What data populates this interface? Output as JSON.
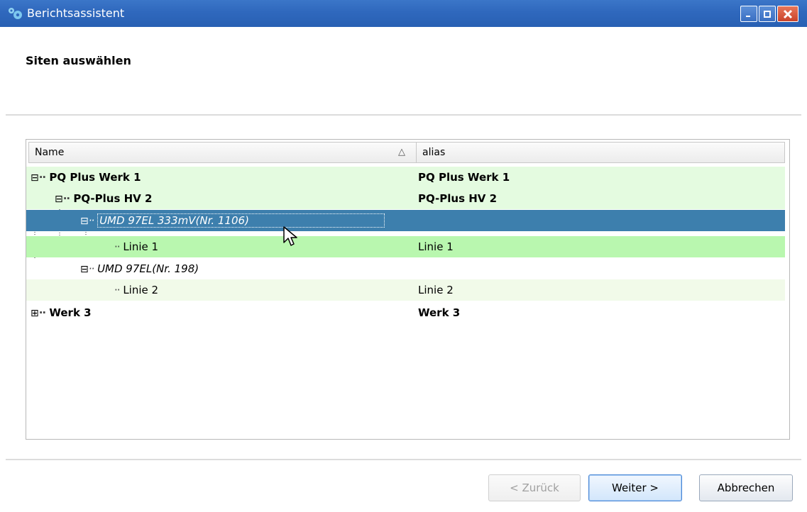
{
  "window": {
    "title": "Berichtsassistent",
    "icon": "gear-icon",
    "controls": [
      "minimize-icon",
      "maximize-icon",
      "close-icon"
    ]
  },
  "page": {
    "heading": "Siten auswählen"
  },
  "tree": {
    "columns": {
      "name": "Name",
      "alias": "alias",
      "sort_indicator": "△"
    },
    "rows": [
      {
        "name": "PQ Plus Werk 1",
        "alias": "PQ Plus Werk 1",
        "level": 0,
        "expander": "⊟"
      },
      {
        "name": "PQ-Plus HV 2",
        "alias": "PQ-Plus HV 2",
        "level": 1,
        "expander": "⊟"
      },
      {
        "name": "UMD 97EL 333mV(Nr. 1106)",
        "alias": "",
        "level": 2,
        "expander": "⊟",
        "selected": true
      },
      {
        "name": "Linie 1",
        "alias": "Linie 1",
        "level": 3
      },
      {
        "name": "UMD 97EL(Nr. 198)",
        "alias": "",
        "level": 2,
        "expander": "⊟"
      },
      {
        "name": "Linie 2",
        "alias": "Linie 2",
        "level": 3
      },
      {
        "name": "Werk 3",
        "alias": "Werk 3",
        "level": 0,
        "expander": "⊞"
      }
    ]
  },
  "buttons": {
    "back": "< Zurück",
    "next": "Weiter >",
    "cancel": "Abbrechen"
  },
  "colors": {
    "titlebar": "#2f68bd",
    "row_green_light": "#e4fbe0",
    "row_green": "#b9f7af",
    "row_green_pale": "#f1fae9",
    "selection": "#3d7fad"
  }
}
